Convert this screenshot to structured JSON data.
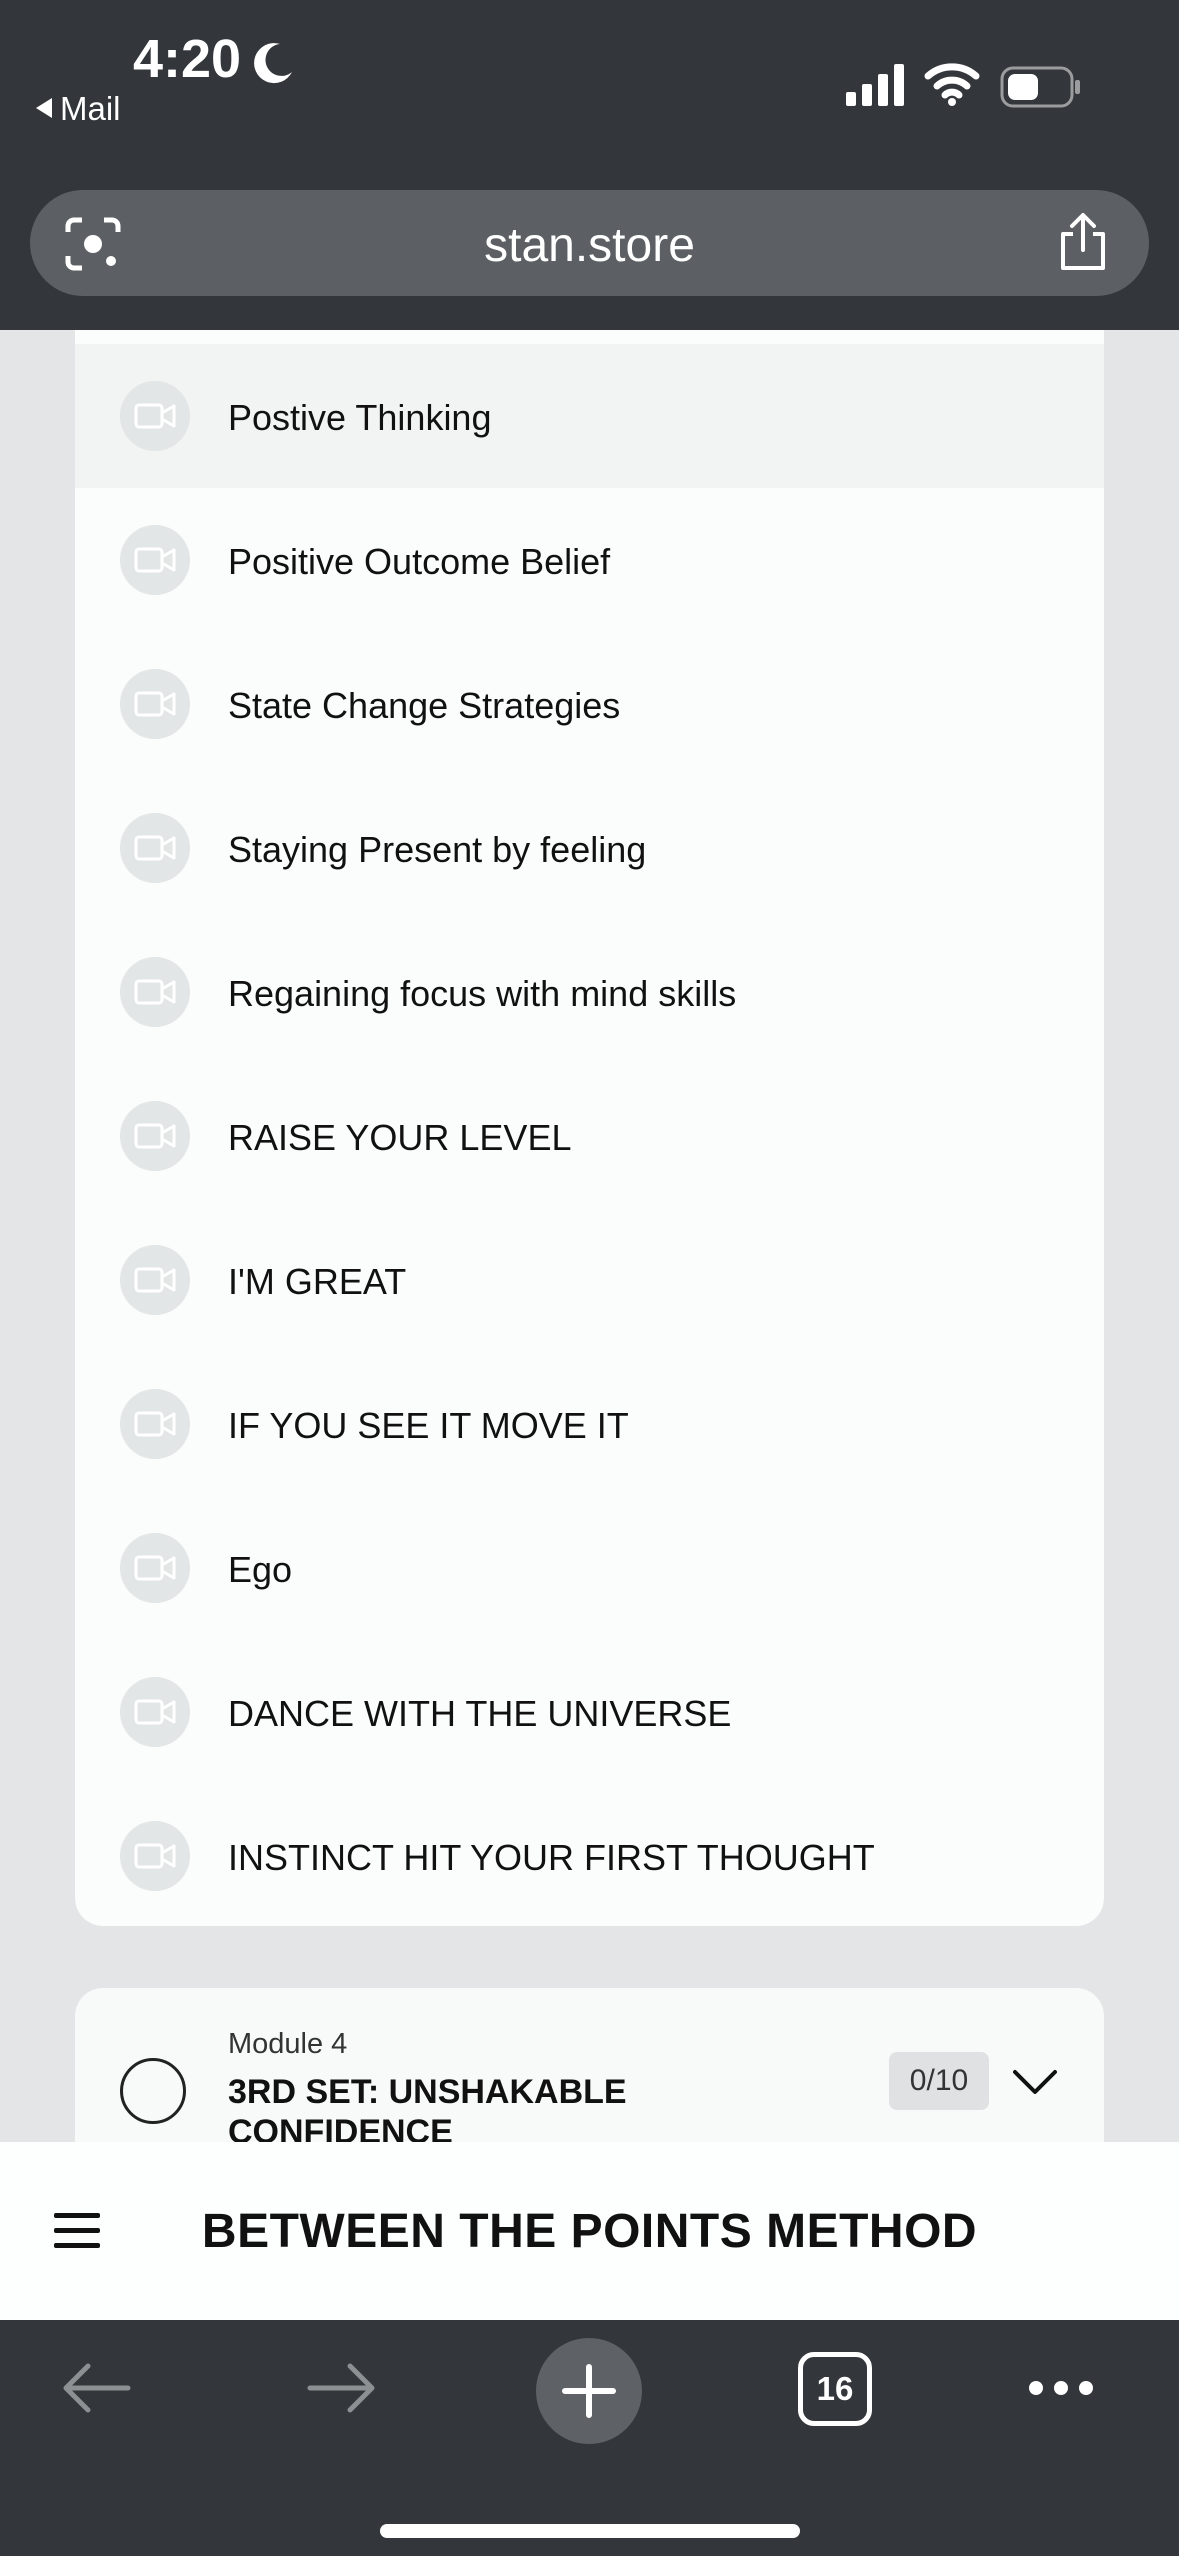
{
  "status_bar": {
    "time": "4:20",
    "back_app": "Mail"
  },
  "browser": {
    "url": "stan.store",
    "open_tabs": "16"
  },
  "lessons": [
    {
      "label": "Postive Thinking",
      "active": true
    },
    {
      "label": "Positive Outcome Belief"
    },
    {
      "label": "State Change Strategies"
    },
    {
      "label": "Staying Present by feeling"
    },
    {
      "label": "Regaining focus with mind skills"
    },
    {
      "label": "RAISE YOUR LEVEL"
    },
    {
      "label": "I'M GREAT"
    },
    {
      "label": "IF YOU SEE IT MOVE IT"
    },
    {
      "label": "Ego"
    },
    {
      "label": "DANCE WITH THE UNIVERSE"
    },
    {
      "label": "INSTINCT HIT YOUR FIRST THOUGHT"
    }
  ],
  "module": {
    "subtitle": "Module 4",
    "title": "3RD SET: UNSHAKABLE CONFIDENCE",
    "progress": "0/10"
  },
  "site_header": {
    "title": "BETWEEN THE POINTS METHOD"
  },
  "icons": {
    "lesson": "video-camera-icon",
    "menu": "hamburger-icon"
  }
}
